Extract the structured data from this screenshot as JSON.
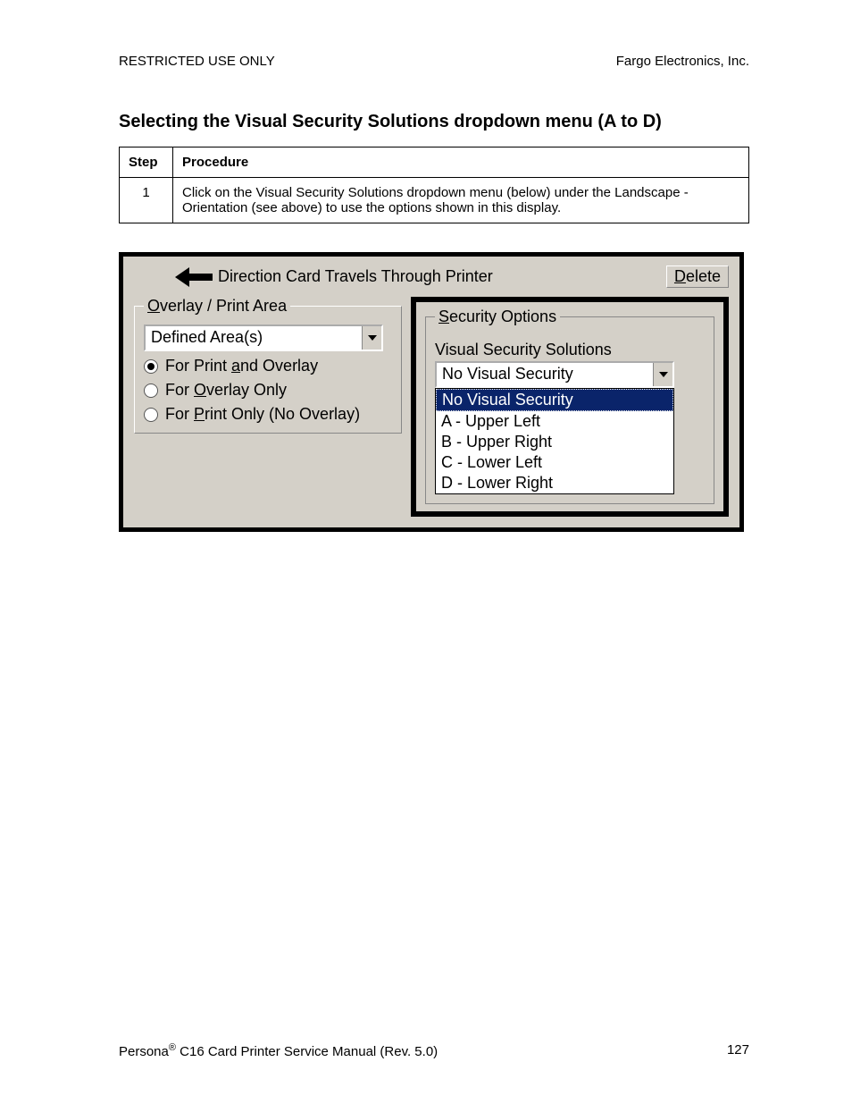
{
  "header": {
    "left": "RESTRICTED USE ONLY",
    "right": "Fargo Electronics, Inc."
  },
  "section_title": "Selecting the Visual Security Solutions dropdown menu (A to D)",
  "table": {
    "head_step": "Step",
    "head_proc": "Procedure",
    "rows": [
      {
        "step": "1",
        "text": "Click on the Visual Security Solutions dropdown menu (below) under the Landscape - Orientation (see above) to use the options shown in this display."
      }
    ]
  },
  "dialog": {
    "direction_label": "Direction Card Travels Through Printer",
    "delete_label_pre": "D",
    "delete_label_rest": "elete",
    "overlay_group": {
      "legend_pre": "O",
      "legend_rest": "verlay / Print Area",
      "combo_value": "Defined Area(s)",
      "radios": [
        {
          "pre": "For Print ",
          "u": "a",
          "post": "nd Overlay",
          "selected": true
        },
        {
          "pre": "For ",
          "u": "O",
          "post": "verlay Only",
          "selected": false
        },
        {
          "pre": "For ",
          "u": "P",
          "post": "rint Only (No Overlay)",
          "selected": false
        }
      ]
    },
    "security_group": {
      "legend_pre": "S",
      "legend_rest": "ecurity Options",
      "subtitle": "Visual Security Solutions",
      "combo_value": "No Visual Security",
      "list": [
        {
          "label": "No Visual Security",
          "selected": true
        },
        {
          "label": "A - Upper Left",
          "selected": false
        },
        {
          "label": "B - Upper Right",
          "selected": false
        },
        {
          "label": "C - Lower Left",
          "selected": false
        },
        {
          "label": "D - Lower Right",
          "selected": false
        }
      ]
    }
  },
  "footer": {
    "left_pre": "Persona",
    "left_reg": "®",
    "left_post": " C16 Card Printer Service Manual (Rev. 5.0)",
    "page": "127"
  }
}
